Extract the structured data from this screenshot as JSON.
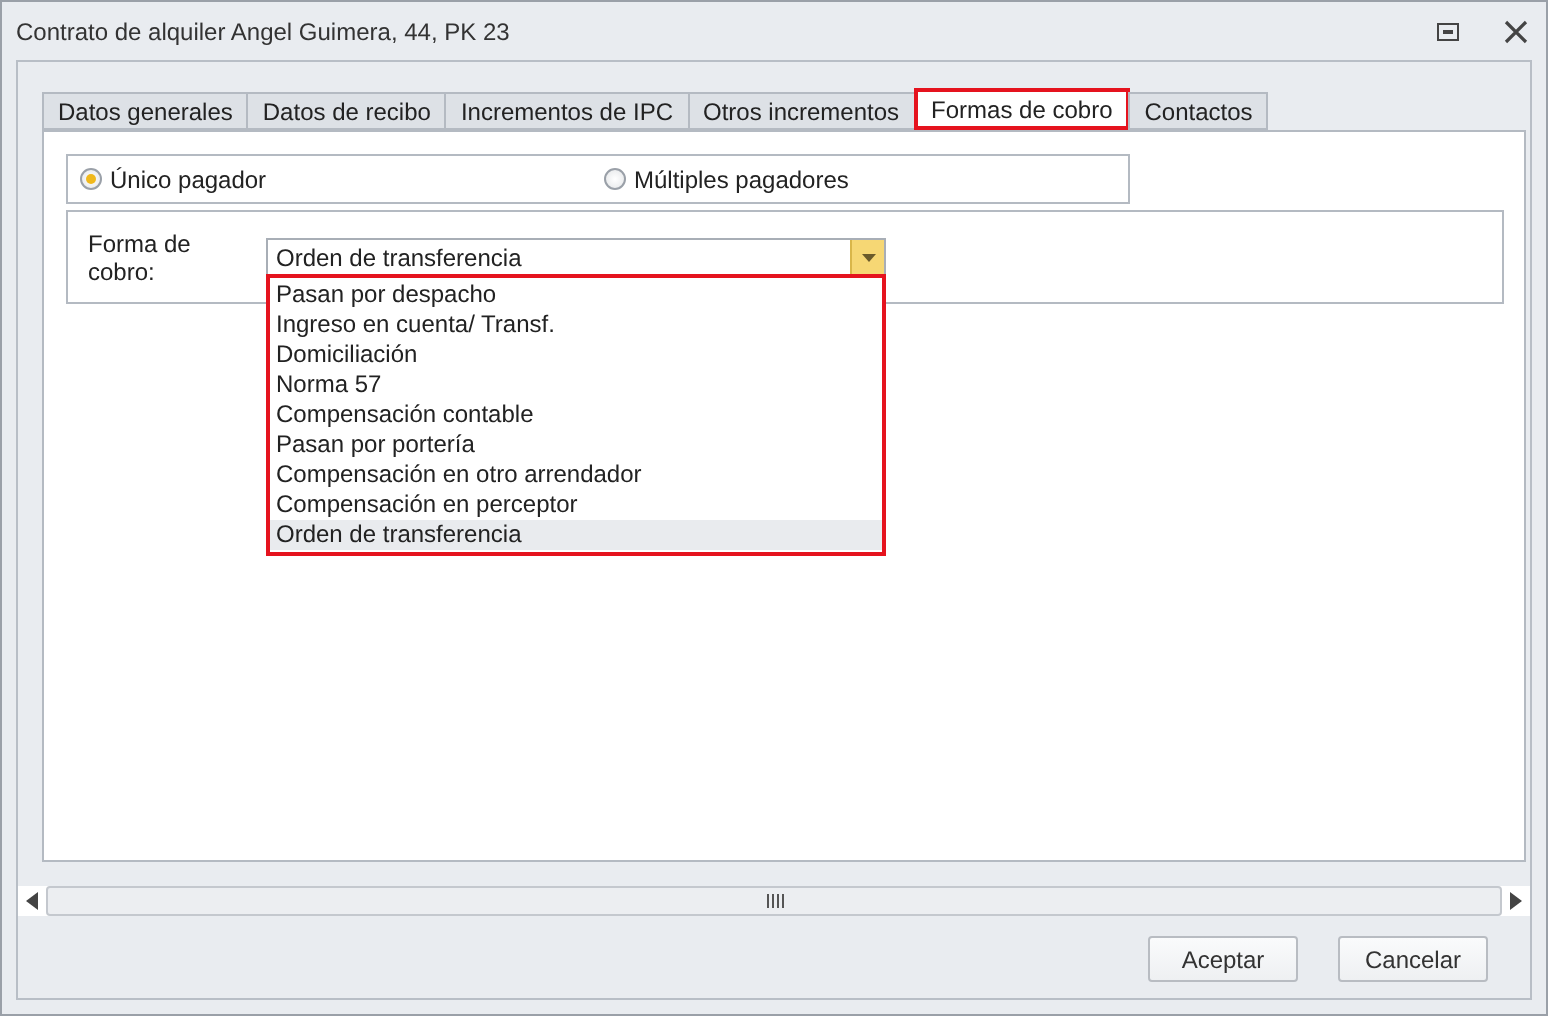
{
  "window": {
    "title": "Contrato de alquiler Angel Guimera, 44, PK 23"
  },
  "tabs": [
    {
      "label": "Datos generales",
      "selected": false
    },
    {
      "label": "Datos de recibo",
      "selected": false
    },
    {
      "label": "Incrementos de IPC",
      "selected": false
    },
    {
      "label": "Otros incrementos",
      "selected": false
    },
    {
      "label": "Formas de cobro",
      "selected": true
    },
    {
      "label": "Contactos",
      "selected": false
    }
  ],
  "payer_options": [
    {
      "label": "Único pagador",
      "selected": true
    },
    {
      "label": "Múltiples pagadores",
      "selected": false
    }
  ],
  "payment_method": {
    "label": "Forma de cobro:",
    "value": "Orden de transferencia",
    "expanded": true,
    "options": [
      {
        "label": "Pasan por despacho",
        "selected": false
      },
      {
        "label": "Ingreso en cuenta/ Transf.",
        "selected": false
      },
      {
        "label": "Domiciliación",
        "selected": false
      },
      {
        "label": "Norma 57",
        "selected": false
      },
      {
        "label": "Compensación contable",
        "selected": false
      },
      {
        "label": "Pasan por portería",
        "selected": false
      },
      {
        "label": "Compensación en otro arrendador",
        "selected": false
      },
      {
        "label": "Compensación en perceptor",
        "selected": false
      },
      {
        "label": "Orden de transferencia",
        "selected": true
      }
    ]
  },
  "buttons": [
    "Aceptar",
    "Cancelar"
  ]
}
